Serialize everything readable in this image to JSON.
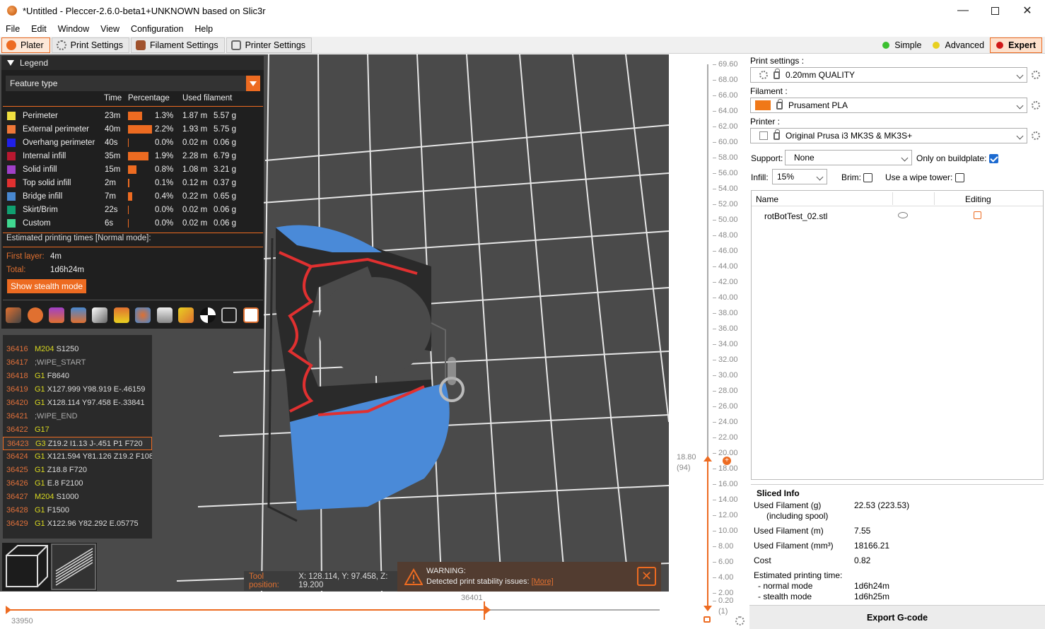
{
  "window": {
    "title": "*Untitled - Pleccer-2.6.0-beta1+UNKNOWN based on Slic3r"
  },
  "menu": [
    "File",
    "Edit",
    "Window",
    "View",
    "Configuration",
    "Help"
  ],
  "tabs": [
    {
      "label": "Plater",
      "active": true
    },
    {
      "label": "Print Settings",
      "active": false
    },
    {
      "label": "Filament Settings",
      "active": false
    },
    {
      "label": "Printer Settings",
      "active": false
    }
  ],
  "modes": [
    {
      "label": "Simple",
      "color": "#3cc030",
      "selected": false
    },
    {
      "label": "Advanced",
      "color": "#e8d020",
      "selected": false
    },
    {
      "label": "Expert",
      "color": "#d01818",
      "selected": true
    }
  ],
  "legend": {
    "title": "Legend",
    "view_type": "Feature type",
    "columns": {
      "time": "Time",
      "percentage": "Percentage",
      "used": "Used filament"
    },
    "features": [
      {
        "name": "Perimeter",
        "color": "#f0e040",
        "time": "23m",
        "pct": "1.3%",
        "m": "1.87 m",
        "g": "5.57 g",
        "pct_value": 1.3
      },
      {
        "name": "External perimeter",
        "color": "#f07838",
        "time": "40m",
        "pct": "2.2%",
        "m": "1.93 m",
        "g": "5.75 g",
        "pct_value": 2.2
      },
      {
        "name": "Overhang perimeter",
        "color": "#2020e8",
        "time": "40s",
        "pct": "0.0%",
        "m": "0.02 m",
        "g": "0.06 g",
        "pct_value": 0.0
      },
      {
        "name": "Internal infill",
        "color": "#b81830",
        "time": "35m",
        "pct": "1.9%",
        "m": "2.28 m",
        "g": "6.79 g",
        "pct_value": 1.9
      },
      {
        "name": "Solid infill",
        "color": "#a040c8",
        "time": "15m",
        "pct": "0.8%",
        "m": "1.08 m",
        "g": "3.21 g",
        "pct_value": 0.8
      },
      {
        "name": "Top solid infill",
        "color": "#e03030",
        "time": "2m",
        "pct": "0.1%",
        "m": "0.12 m",
        "g": "0.37 g",
        "pct_value": 0.1
      },
      {
        "name": "Bridge infill",
        "color": "#4888d0",
        "time": "7m",
        "pct": "0.4%",
        "m": "0.22 m",
        "g": "0.65 g",
        "pct_value": 0.4
      },
      {
        "name": "Skirt/Brim",
        "color": "#10a070",
        "time": "22s",
        "pct": "0.0%",
        "m": "0.02 m",
        "g": "0.06 g",
        "pct_value": 0.0
      },
      {
        "name": "Custom",
        "color": "#40d890",
        "time": "6s",
        "pct": "0.0%",
        "m": "0.02 m",
        "g": "0.06 g",
        "pct_value": 0.0
      }
    ],
    "estimated_title": "Estimated printing times [Normal mode]:",
    "first_layer_label": "First layer:",
    "first_layer_value": "4m",
    "total_label": "Total:",
    "total_value": "1d6h24m",
    "stealth_button": "Show stealth mode"
  },
  "gcode": [
    {
      "n": "36416",
      "cmd": "M204",
      "args": " S1250"
    },
    {
      "n": "36417",
      "cmd": "",
      "args": ";WIPE_START"
    },
    {
      "n": "36418",
      "cmd": "G1",
      "args": " F8640"
    },
    {
      "n": "36419",
      "cmd": "G1",
      "args": " X127.999 Y98.919 E-.46159"
    },
    {
      "n": "36420",
      "cmd": "G1",
      "args": " X128.114 Y97.458 E-.33841"
    },
    {
      "n": "36421",
      "cmd": "",
      "args": ";WIPE_END"
    },
    {
      "n": "36422",
      "cmd": "G17",
      "args": ""
    },
    {
      "n": "36423",
      "cmd": "G3",
      "args": " Z19.2 I1.13 J-.451 P1  F720"
    },
    {
      "n": "36424",
      "cmd": "G1",
      "args": " X121.594 Y81.126 Z19.2 F108"
    },
    {
      "n": "36425",
      "cmd": "G1",
      "args": " Z18.8 F720"
    },
    {
      "n": "36426",
      "cmd": "G1",
      "args": " E.8 F2100"
    },
    {
      "n": "36427",
      "cmd": "M204",
      "args": " S1000"
    },
    {
      "n": "36428",
      "cmd": "G1",
      "args": " F1500"
    },
    {
      "n": "36429",
      "cmd": "G1",
      "args": " X122.96 Y82.292 E.05775"
    }
  ],
  "toolpos": {
    "label": "Tool position:",
    "value": "X: 128.114, Y: 97.458, Z: 19.200"
  },
  "warning": {
    "title": "WARNING:",
    "text": "Detected print stability issues:",
    "link": "[More]"
  },
  "hslider": {
    "left": "33950",
    "current": "36401",
    "fraction": 0.73
  },
  "vslider": {
    "ticks": [
      "69.60",
      "68.00",
      "66.00",
      "64.00",
      "62.00",
      "60.00",
      "58.00",
      "56.00",
      "54.00",
      "52.00",
      "50.00",
      "48.00",
      "46.00",
      "44.00",
      "42.00",
      "40.00",
      "38.00",
      "36.00",
      "34.00",
      "32.00",
      "30.00",
      "28.00",
      "26.00",
      "24.00",
      "22.00",
      "20.00",
      "18.00",
      "16.00",
      "14.00",
      "12.00",
      "10.00",
      "8.00",
      "6.00",
      "4.00",
      "2.00",
      "0.20"
    ],
    "bottom_index": "(1)",
    "current": "18.80",
    "current_index": "(94)"
  },
  "right": {
    "print_label": "Print settings :",
    "print_value": "0.20mm QUALITY",
    "filament_label": "Filament :",
    "filament_value": "Prusament PLA",
    "filament_color": "#f07818",
    "printer_label": "Printer :",
    "printer_value": "Original Prusa i3 MK3S & MK3S+",
    "support_label": "Support:",
    "support_value": "None",
    "buildplate_label": "Only on buildplate:",
    "infill_label": "Infill:",
    "infill_value": "15%",
    "brim_label": "Brim:",
    "wipe_label": "Use a wipe tower:",
    "col_name": "Name",
    "col_editing": "Editing",
    "object": "rotBotTest_02.stl",
    "sliced_title": "Sliced Info",
    "sliced": [
      {
        "label": "Used Filament (g)",
        "sub": "(including spool)",
        "value": "22.53 (223.53)"
      },
      {
        "label": "Used Filament (m)",
        "value": "7.55"
      },
      {
        "label": "Used Filament (mm³)",
        "value": "18166.21"
      },
      {
        "label": "Cost",
        "value": "0.82"
      }
    ],
    "est_label": "Estimated printing time:",
    "normal_label": "- normal mode",
    "normal_value": "1d6h24m",
    "stealth_label": "- stealth mode",
    "stealth_value": "1d6h25m",
    "export": "Export G-code"
  }
}
